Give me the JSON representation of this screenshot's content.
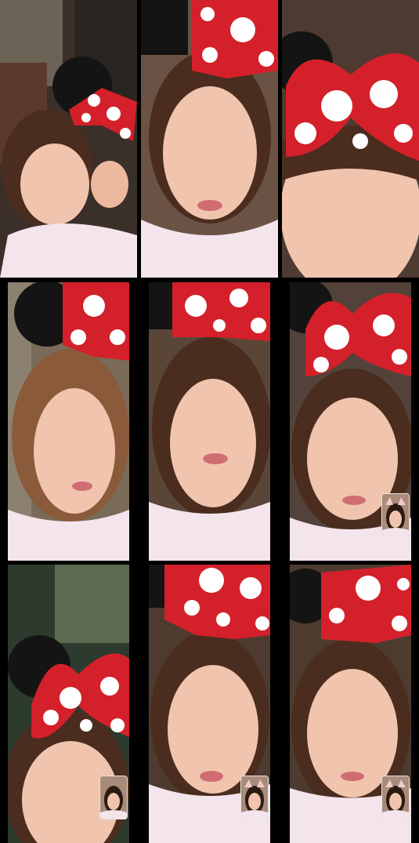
{
  "collage": {
    "rows": 3,
    "columns": 3,
    "tiles": [
      {
        "subject": "woman-with-polka-dot-bow-headband",
        "pip": false
      },
      {
        "subject": "woman-with-polka-dot-bow-headband",
        "pip": false
      },
      {
        "subject": "woman-with-polka-dot-bow-headband",
        "pip": false
      },
      {
        "subject": "woman-with-polka-dot-bow-headband",
        "pip": false
      },
      {
        "subject": "woman-with-polka-dot-bow-headband",
        "pip": false
      },
      {
        "subject": "woman-with-polka-dot-bow-headband",
        "pip": true
      },
      {
        "subject": "woman-with-polka-dot-bow-headband",
        "pip": true
      },
      {
        "subject": "woman-with-polka-dot-bow-headband",
        "pip": true
      },
      {
        "subject": "woman-with-polka-dot-bow-headband",
        "pip": true
      }
    ]
  },
  "colors": {
    "background": "#000000",
    "bow_red": "#d4202a",
    "bow_dots": "#ffffff",
    "ears": "#141414",
    "hair": "#4a2d1e",
    "skin": "#f1c4ad",
    "shirt": "#f4e4ec"
  }
}
